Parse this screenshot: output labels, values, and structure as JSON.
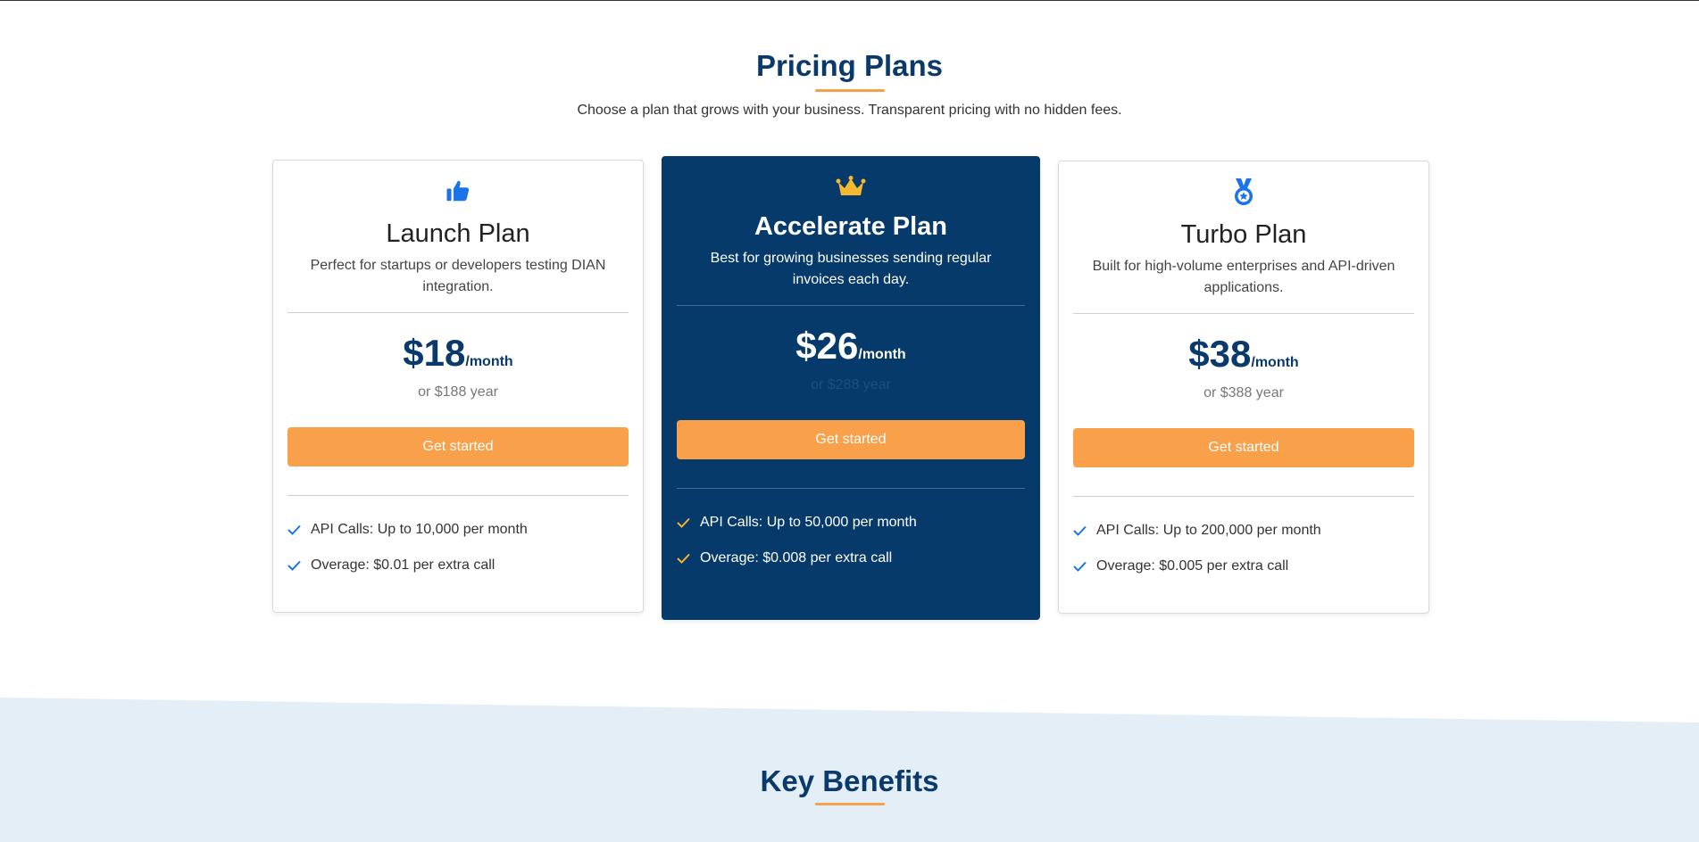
{
  "header": {
    "title": "Pricing Plans",
    "subtitle": "Choose a plan that grows with your business. Transparent pricing with no hidden fees."
  },
  "plans": [
    {
      "icon": "thumbs-up-icon",
      "name": "Launch Plan",
      "description": "Perfect for startups or developers testing DIAN integration.",
      "price": "$18",
      "period": "/month",
      "yearly": "or $188 year",
      "cta": "Get started",
      "features": [
        "API Calls: Up to 10,000 per month",
        "Overage: $0.01 per extra call"
      ]
    },
    {
      "icon": "crown-icon",
      "name": "Accelerate Plan",
      "description": "Best for growing businesses sending regular invoices each day.",
      "price": "$26",
      "period": "/month",
      "yearly": "or $288 year",
      "cta": "Get started",
      "features": [
        "API Calls: Up to 50,000 per month",
        "Overage: $0.008 per extra call"
      ]
    },
    {
      "icon": "medal-icon",
      "name": "Turbo Plan",
      "description": "Built for high-volume enterprises and API-driven applications.",
      "price": "$38",
      "period": "/month",
      "yearly": "or $388 year",
      "cta": "Get started",
      "features": [
        "API Calls: Up to 200,000 per month",
        "Overage: $0.005 per extra call"
      ]
    }
  ],
  "benefits": {
    "title": "Key Benefits"
  },
  "colors": {
    "primary": "#0a3a6b",
    "accent": "#f9a04b",
    "icon_blue": "#1a73e8",
    "crown_gold": "#f5b82e",
    "band": "#e4eef7"
  }
}
